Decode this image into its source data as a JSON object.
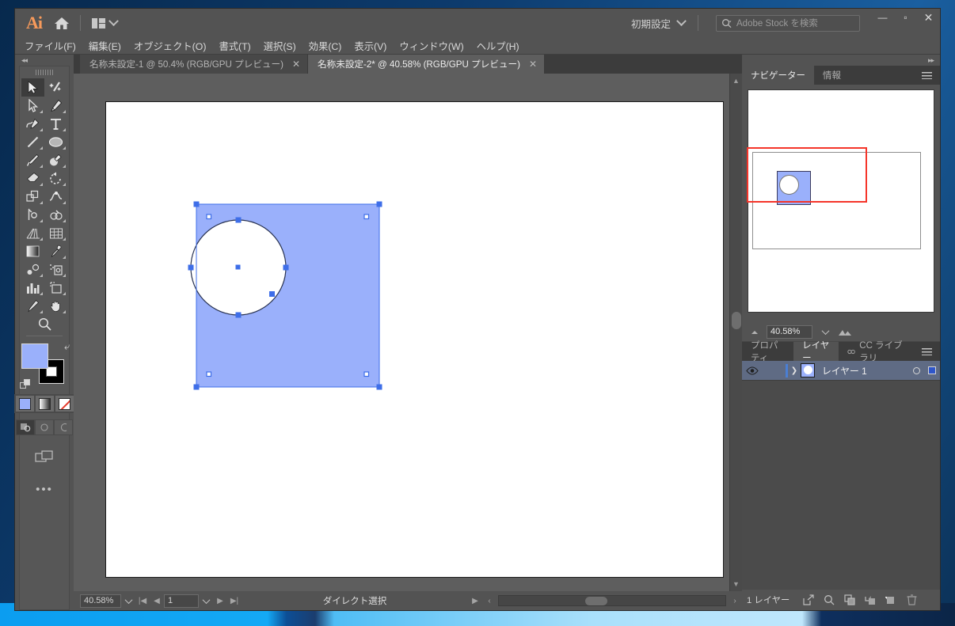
{
  "app": {
    "name": "Adobe Illustrator",
    "logo_text": "Ai",
    "home_icon": "home-icon",
    "arrange_icon": "arrange-documents-icon",
    "workspace_label": "初期設定",
    "search_placeholder": "Adobe Stock を検索",
    "search_icon": "search-icon",
    "window_controls": {
      "minimize": "—",
      "maximize": "▫",
      "close": "✕"
    }
  },
  "menubar": {
    "items": [
      {
        "label": "ファイル(F)"
      },
      {
        "label": "編集(E)"
      },
      {
        "label": "オブジェクト(O)"
      },
      {
        "label": "書式(T)"
      },
      {
        "label": "選択(S)"
      },
      {
        "label": "効果(C)"
      },
      {
        "label": "表示(V)"
      },
      {
        "label": "ウィンドウ(W)"
      },
      {
        "label": "ヘルプ(H)"
      }
    ]
  },
  "tabs": [
    {
      "label": "名称未設定-1 @ 50.4% (RGB/GPU プレビュー)",
      "active": false,
      "close": "✕"
    },
    {
      "label": "名称未設定-2* @ 40.58% (RGB/GPU プレビュー)",
      "active": true,
      "close": "✕"
    }
  ],
  "toolbar": {
    "collapse_icon": "double-chevron-left-icon",
    "tools": [
      {
        "name": "selection-tool",
        "label": "選択ツール",
        "active": true
      },
      {
        "name": "magic-wand-tool",
        "label": "自動選択ツール",
        "active": false
      },
      {
        "name": "direct-selection-tool",
        "label": "ダイレクト選択ツール",
        "active": false
      },
      {
        "name": "pen-tool",
        "label": "ペンツール",
        "active": false
      },
      {
        "name": "curvature-tool",
        "label": "曲線ツール",
        "active": false
      },
      {
        "name": "type-tool",
        "label": "文字ツール",
        "active": false
      },
      {
        "name": "line-segment-tool",
        "label": "直線ツール",
        "active": false
      },
      {
        "name": "ellipse-tool",
        "label": "楕円形ツール",
        "active": false
      },
      {
        "name": "paintbrush-tool",
        "label": "ブラシツール",
        "active": false
      },
      {
        "name": "blob-brush-tool",
        "label": "塗りブラシツール",
        "active": false
      },
      {
        "name": "eraser-tool",
        "label": "消しゴムツール",
        "active": false
      },
      {
        "name": "rotate-tool",
        "label": "回転ツール",
        "active": false
      },
      {
        "name": "scale-tool",
        "label": "拡大・縮小ツール",
        "active": false
      },
      {
        "name": "width-tool",
        "label": "線幅ツール",
        "active": false
      },
      {
        "name": "free-transform-tool",
        "label": "自由変形ツール",
        "active": false
      },
      {
        "name": "shape-builder-tool",
        "label": "シェイプ形成ツール",
        "active": false
      },
      {
        "name": "perspective-grid-tool",
        "label": "遠近グリッドツール",
        "active": false
      },
      {
        "name": "mesh-tool",
        "label": "メッシュツール",
        "active": false
      },
      {
        "name": "gradient-tool",
        "label": "グラデーションツール",
        "active": false
      },
      {
        "name": "eyedropper-tool",
        "label": "スポイトツール",
        "active": false
      },
      {
        "name": "blend-tool",
        "label": "ブレンドツール",
        "active": false
      },
      {
        "name": "symbol-sprayer-tool",
        "label": "シンボルスプレーツール",
        "active": false
      },
      {
        "name": "column-graph-tool",
        "label": "グラフツール",
        "active": false
      },
      {
        "name": "artboard-tool",
        "label": "アートボードツール",
        "active": false
      },
      {
        "name": "slice-tool",
        "label": "スライスツール",
        "active": false
      },
      {
        "name": "hand-tool",
        "label": "手のひらツール",
        "active": false
      },
      {
        "name": "zoom-tool",
        "label": "ズームツール",
        "active": false
      }
    ],
    "fill_color": "#9AB0FB",
    "stroke_color": "#000000",
    "swap_icon": "swap-fill-stroke-icon",
    "default_icon": "default-fill-stroke-icon",
    "paint_modes": [
      {
        "name": "color-mode",
        "active": true
      },
      {
        "name": "gradient-mode",
        "active": false
      },
      {
        "name": "none-mode",
        "active": false
      }
    ],
    "draw_modes": [
      {
        "name": "draw-normal-mode",
        "active": true
      },
      {
        "name": "draw-behind-mode",
        "active": false
      },
      {
        "name": "draw-inside-mode",
        "active": false
      }
    ],
    "screen_mode_icon": "change-screen-mode-icon",
    "more_tools_icon": "edit-toolbar-ellipsis-icon"
  },
  "canvas": {
    "artboard_background": "#FFFFFF",
    "workspace_background": "#5E5E5E",
    "artwork": {
      "rectangle": {
        "fill": "#9AB0FB",
        "stroke": "#3A4A8C",
        "selected": true
      },
      "circle": {
        "fill": "#FFFFFF",
        "stroke": "#26304F",
        "selected": true
      },
      "selection_color": "#3E6EE8"
    }
  },
  "statusbar": {
    "zoom": "40.58%",
    "page": "1",
    "tool_name": "ダイレクト選択",
    "first_icon": "first-page-icon",
    "prev_icon": "previous-page-icon",
    "next_icon": "next-page-icon",
    "last_icon": "last-page-icon"
  },
  "navigator": {
    "tabs": [
      {
        "label": "ナビゲーター",
        "active": true
      },
      {
        "label": "情報",
        "active": false
      }
    ],
    "menu_icon": "panel-menu-icon",
    "zoom": "40.58%",
    "zoom_out_icon": "zoom-out-mountain-small-icon",
    "zoom_in_icon": "zoom-in-mountain-large-icon",
    "view_box_color": "#F5352A"
  },
  "layers_panel": {
    "tabs": [
      {
        "label": "プロパティ",
        "active": false
      },
      {
        "label": "レイヤー",
        "active": true
      },
      {
        "label": "CC ライブラリ",
        "active": false,
        "icon": "cc-libraries-icon"
      }
    ],
    "menu_icon": "panel-menu-icon",
    "rows": [
      {
        "visibility_icon": "eye-icon",
        "expand_icon": "chevron-right-icon",
        "thumbnail": "layer-thumbnail",
        "name": "レイヤー 1",
        "target_icon": "target-circle-icon",
        "selected": true,
        "selection_color": "#2F56C9"
      }
    ],
    "footer": {
      "count_label": "1 レイヤー",
      "buttons": [
        {
          "name": "release-to-layers-icon"
        },
        {
          "name": "locate-object-icon"
        },
        {
          "name": "make-clipping-mask-icon"
        },
        {
          "name": "create-new-sublayer-icon"
        },
        {
          "name": "create-new-layer-icon"
        },
        {
          "name": "delete-selection-icon"
        }
      ]
    }
  }
}
